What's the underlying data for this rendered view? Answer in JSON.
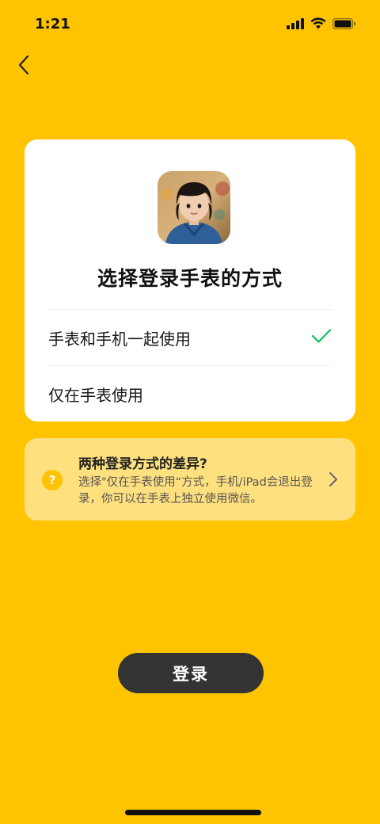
{
  "status_bar": {
    "time": "1:21"
  },
  "card": {
    "title": "选择登录手表的方式",
    "options": [
      {
        "label": "手表和手机一起使用",
        "selected": true
      },
      {
        "label": "仅在手表使用",
        "selected": false
      }
    ]
  },
  "info": {
    "icon": "?",
    "title": "两种登录方式的差异?",
    "description": "选择\"仅在手表使用“方式，手机/iPad会退出登录，你可以在手表上独立使用微信。"
  },
  "login_button": {
    "label": "登录"
  },
  "colors": {
    "background": "#FFC300",
    "card": "#FFFFFF",
    "info_card": "#FFE07E",
    "check": "#07C160",
    "button": "#333333"
  }
}
